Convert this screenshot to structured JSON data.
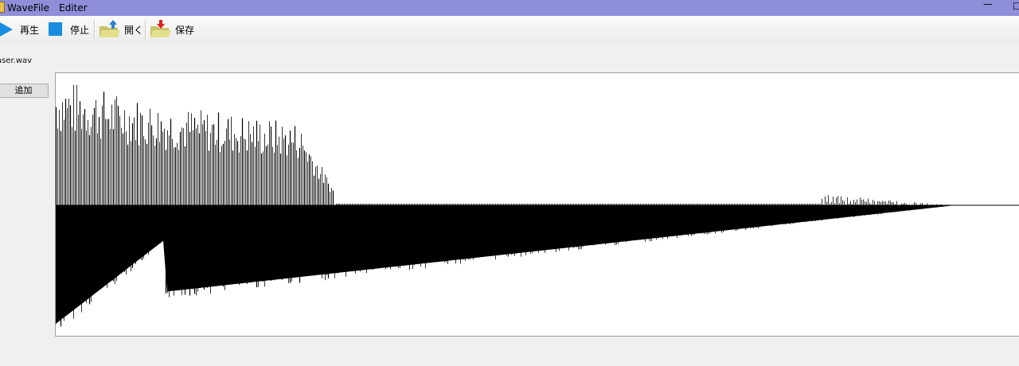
{
  "window": {
    "title": "WaveFile　Editer",
    "minimize_glyph": "—",
    "maximize_glyph": "☐"
  },
  "toolbar": {
    "play_label": "再生",
    "stop_label": "停止",
    "open_label": "開く",
    "save_label": "保存",
    "play_color": "#1a8de0",
    "stop_color": "#1a8de0"
  },
  "file": {
    "name": "aser.wav"
  },
  "add_button": {
    "label": "追加"
  },
  "waveform": {
    "color": "#000000",
    "background": "#ffffff"
  }
}
